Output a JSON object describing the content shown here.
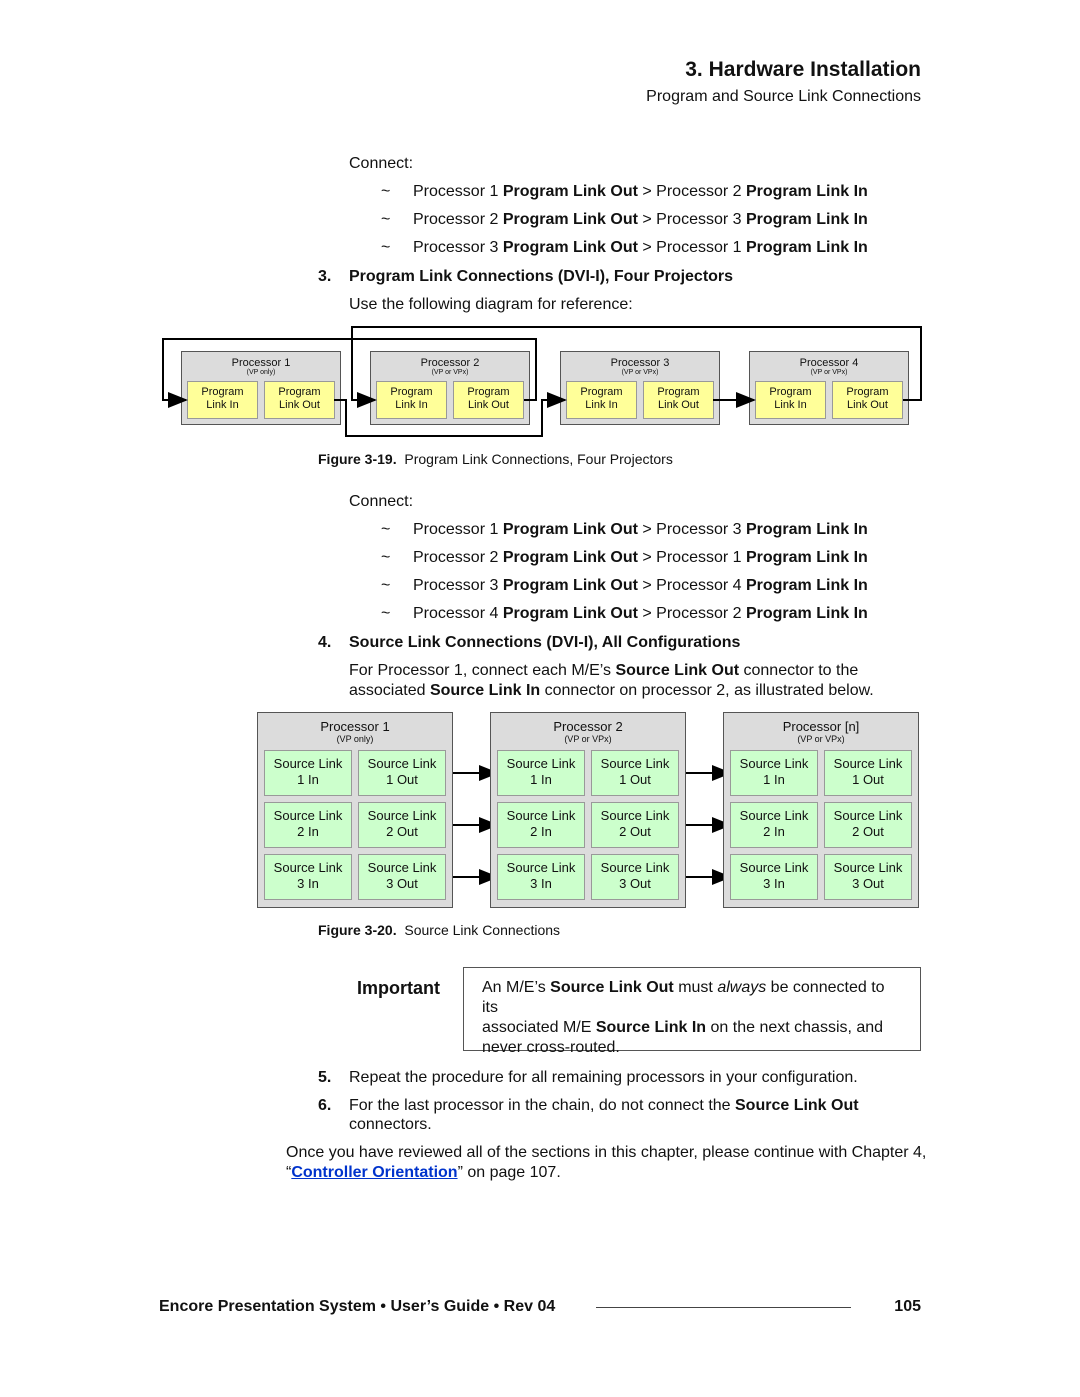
{
  "header": {
    "title": "3.  Hardware Installation",
    "subtitle": "Program and Source Link Connections"
  },
  "block1": {
    "connect": "Connect:",
    "items": [
      {
        "a": "Processor 1 ",
        "b": "Program Link Out",
        "c": " > Processor 2 ",
        "d": "Program Link In"
      },
      {
        "a": "Processor 2 ",
        "b": "Program Link Out",
        "c": " > Processor 3 ",
        "d": "Program Link In"
      },
      {
        "a": "Processor 3 ",
        "b": "Program Link Out",
        "c": " > Processor 1 ",
        "d": "Program Link In"
      }
    ]
  },
  "step3": {
    "num": "3.",
    "title": "Program Link Connections (DVI-I), Four Projectors",
    "text": "Use the following diagram for reference:"
  },
  "fig19": {
    "processors": [
      {
        "name": "Processor 1",
        "sub": "(VP only)"
      },
      {
        "name": "Processor 2",
        "sub": "(VP or VPx)"
      },
      {
        "name": "Processor 3",
        "sub": "(VP or VPx)"
      },
      {
        "name": "Processor 4",
        "sub": "(VP or VPx)"
      }
    ],
    "in_label": [
      "Program",
      "Link In"
    ],
    "out_label": [
      "Program",
      "Link Out"
    ],
    "caption_num": "Figure 3-19.",
    "caption": "Program Link Connections, Four Projectors"
  },
  "block2": {
    "connect": "Connect:",
    "items": [
      {
        "a": "Processor 1 ",
        "b": "Program Link Out",
        "c": " > Processor 3 ",
        "d": "Program Link In"
      },
      {
        "a": "Processor 2 ",
        "b": "Program Link Out",
        "c": " > Processor 1 ",
        "d": "Program Link In"
      },
      {
        "a": "Processor 3 ",
        "b": "Program Link Out",
        "c": " > Processor 4 ",
        "d": "Program Link In"
      },
      {
        "a": "Processor 4 ",
        "b": "Program Link Out",
        "c": " > Processor 2 ",
        "d": "Program Link In"
      }
    ]
  },
  "step4": {
    "num": "4.",
    "title": "Source Link Connections (DVI-I), All Configurations",
    "l1a": "For Processor 1, connect each M/E’s ",
    "l1b": "Source Link Out",
    "l1c": " connector to the",
    "l2a": "associated ",
    "l2b": "Source Link In",
    "l2c": " connector on processor 2, as illustrated below."
  },
  "fig20": {
    "processors": [
      {
        "name": "Processor 1",
        "sub": "(VP only)"
      },
      {
        "name": "Processor 2",
        "sub": "(VP or VPx)"
      },
      {
        "name": "Processor [n]",
        "sub": "(VP or VPx)"
      }
    ],
    "label": "Source Link",
    "rows": [
      "1",
      "2",
      "3"
    ],
    "in": "In",
    "out": "Out",
    "caption_num": "Figure 3-20.",
    "caption": "Source Link Connections"
  },
  "important": {
    "label": "Important",
    "t1": "An M/E’s ",
    "t2": "Source Link Out",
    "t3": " must ",
    "t4": "always",
    "t5": " be connected to its",
    "t6": "associated M/E ",
    "t7": "Source Link In",
    "t8": " on the next chassis, and",
    "t9": "never cross-routed."
  },
  "step5": {
    "num": "5.",
    "text": "Repeat the procedure for all remaining processors in your configuration."
  },
  "step6": {
    "num": "6.",
    "a": "For the last processor in the chain, do not connect the ",
    "b": "Source Link Out",
    "c": "connectors."
  },
  "closing": {
    "a": "Once you have reviewed all of the sections in this chapter, please continue with Chapter 4,",
    "q1": "“",
    "link": "Controller Orientation",
    "b": "” on page 107."
  },
  "footer": {
    "left": "Encore Presentation System  •  User’s Guide  •  Rev 04",
    "page": "105"
  }
}
